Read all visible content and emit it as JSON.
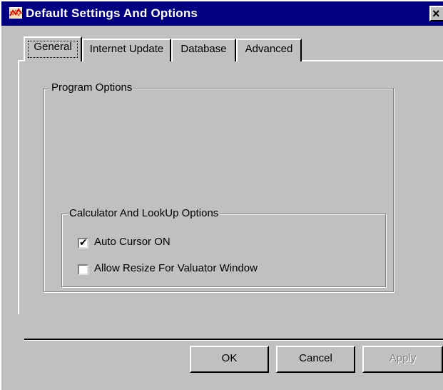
{
  "window": {
    "title": "Default Settings And Options",
    "close_glyph": "×"
  },
  "tabs": [
    {
      "label": "General",
      "selected": true
    },
    {
      "label": "Internet Update",
      "selected": false
    },
    {
      "label": "Database",
      "selected": false
    },
    {
      "label": "Advanced",
      "selected": false
    }
  ],
  "program_options": {
    "legend": "Program Options",
    "calculator_group": {
      "legend": "Calculator And LookUp Options",
      "options": [
        {
          "label": "Auto Cursor ON",
          "checked": true,
          "mark": "✔"
        },
        {
          "label": "Allow Resize For Valuator Window",
          "checked": false,
          "mark": ""
        }
      ]
    }
  },
  "buttons": {
    "ok": "OK",
    "cancel": "Cancel",
    "apply": "Apply"
  },
  "colors": {
    "title_bar": "#000080",
    "face": "#c0c0c0",
    "disabled_text": "#808080"
  },
  "icons": {
    "app": "chart-app-icon",
    "close": "close-icon",
    "check": "checkmark-icon"
  }
}
